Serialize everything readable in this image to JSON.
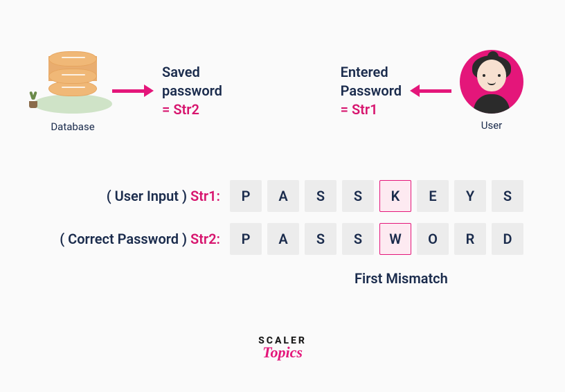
{
  "top": {
    "database_label": "Database",
    "saved_line1": "Saved",
    "saved_line2": "password",
    "saved_eq": "= Str2",
    "entered_line1": "Entered",
    "entered_line2": "Password",
    "entered_eq": "= Str1",
    "user_label": "User"
  },
  "strings": {
    "row1_paren": "( User Input )",
    "row1_var": "Str1:",
    "row1_cells": [
      "P",
      "A",
      "S",
      "S",
      "K",
      "E",
      "Y",
      "S"
    ],
    "row2_paren": "( Correct Password )",
    "row2_var": "Str2:",
    "row2_cells": [
      "P",
      "A",
      "S",
      "S",
      "W",
      "O",
      "R",
      "D"
    ],
    "mismatch_index": 4,
    "mismatch_label": "First Mismatch"
  },
  "logo": {
    "line1": "SCALER",
    "line2": "Topics"
  }
}
